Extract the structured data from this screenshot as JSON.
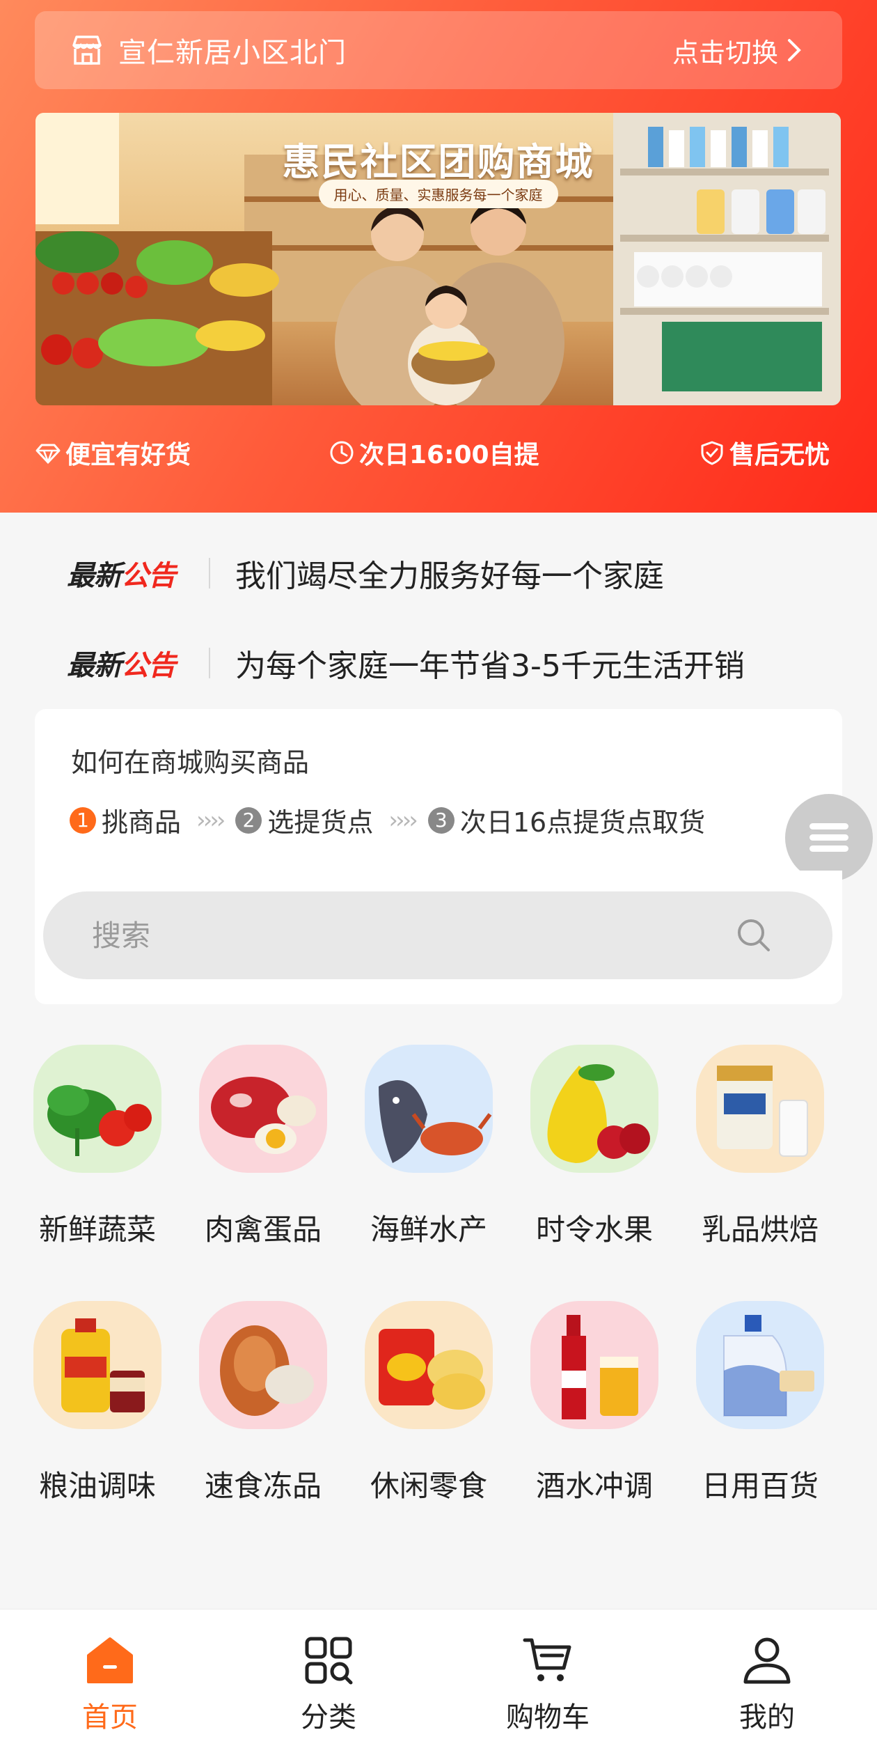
{
  "location": {
    "name": "宣仁新居小区北门",
    "switch_label": "点击切换"
  },
  "banner": {
    "title": "惠民社区团购商城",
    "subtitle": "用心、质量、实惠服务每一个家庭"
  },
  "features": [
    {
      "label": "便宜有好货",
      "icon": "diamond-icon"
    },
    {
      "label": "次日16:00自提",
      "icon": "clock-icon"
    },
    {
      "label": "售后无忧",
      "icon": "shield-icon"
    }
  ],
  "notices": [
    {
      "badge_a": "最新",
      "badge_b": "公告",
      "text": "我们竭尽全力服务好每一个家庭"
    },
    {
      "badge_a": "最新",
      "badge_b": "公告",
      "text": "为每个家庭一年节省3-5千元生活开销"
    }
  ],
  "howto": {
    "title": "如何在商城购买商品",
    "steps": [
      {
        "num": "1",
        "label": "挑商品"
      },
      {
        "num": "2",
        "label": "选提货点"
      },
      {
        "num": "3",
        "label": "次日16点提货点取货"
      }
    ],
    "arrows": "››››"
  },
  "search": {
    "placeholder": "搜索"
  },
  "categories": [
    {
      "label": "新鲜蔬菜",
      "icon": "vegetables-icon",
      "color": "#d8f0c8"
    },
    {
      "label": "肉禽蛋品",
      "icon": "meat-icon",
      "color": "#fbd8dc"
    },
    {
      "label": "海鲜水产",
      "icon": "seafood-icon",
      "color": "#d8e8fb"
    },
    {
      "label": "时令水果",
      "icon": "fruit-icon",
      "color": "#d8f0c8"
    },
    {
      "label": "乳品烘焙",
      "icon": "dairy-icon",
      "color": "#fbe8c8"
    },
    {
      "label": "粮油调味",
      "icon": "oil-icon",
      "color": "#fbe8c8"
    },
    {
      "label": "速食冻品",
      "icon": "frozen-food-icon",
      "color": "#fbd8dc"
    },
    {
      "label": "休闲零食",
      "icon": "snacks-icon",
      "color": "#fbe8c8"
    },
    {
      "label": "酒水冲调",
      "icon": "drinks-icon",
      "color": "#fbd8dc"
    },
    {
      "label": "日用百货",
      "icon": "daily-goods-icon",
      "color": "#d8e8fb"
    }
  ],
  "nav": [
    {
      "label": "首页",
      "icon": "home-icon",
      "active": true
    },
    {
      "label": "分类",
      "icon": "category-icon",
      "active": false
    },
    {
      "label": "购物车",
      "icon": "cart-icon",
      "active": false
    },
    {
      "label": "我的",
      "icon": "user-icon",
      "active": false
    }
  ],
  "colors": {
    "accent": "#ff6a1a",
    "header_start": "#ff8a5c",
    "header_end": "#ff2a1a"
  }
}
